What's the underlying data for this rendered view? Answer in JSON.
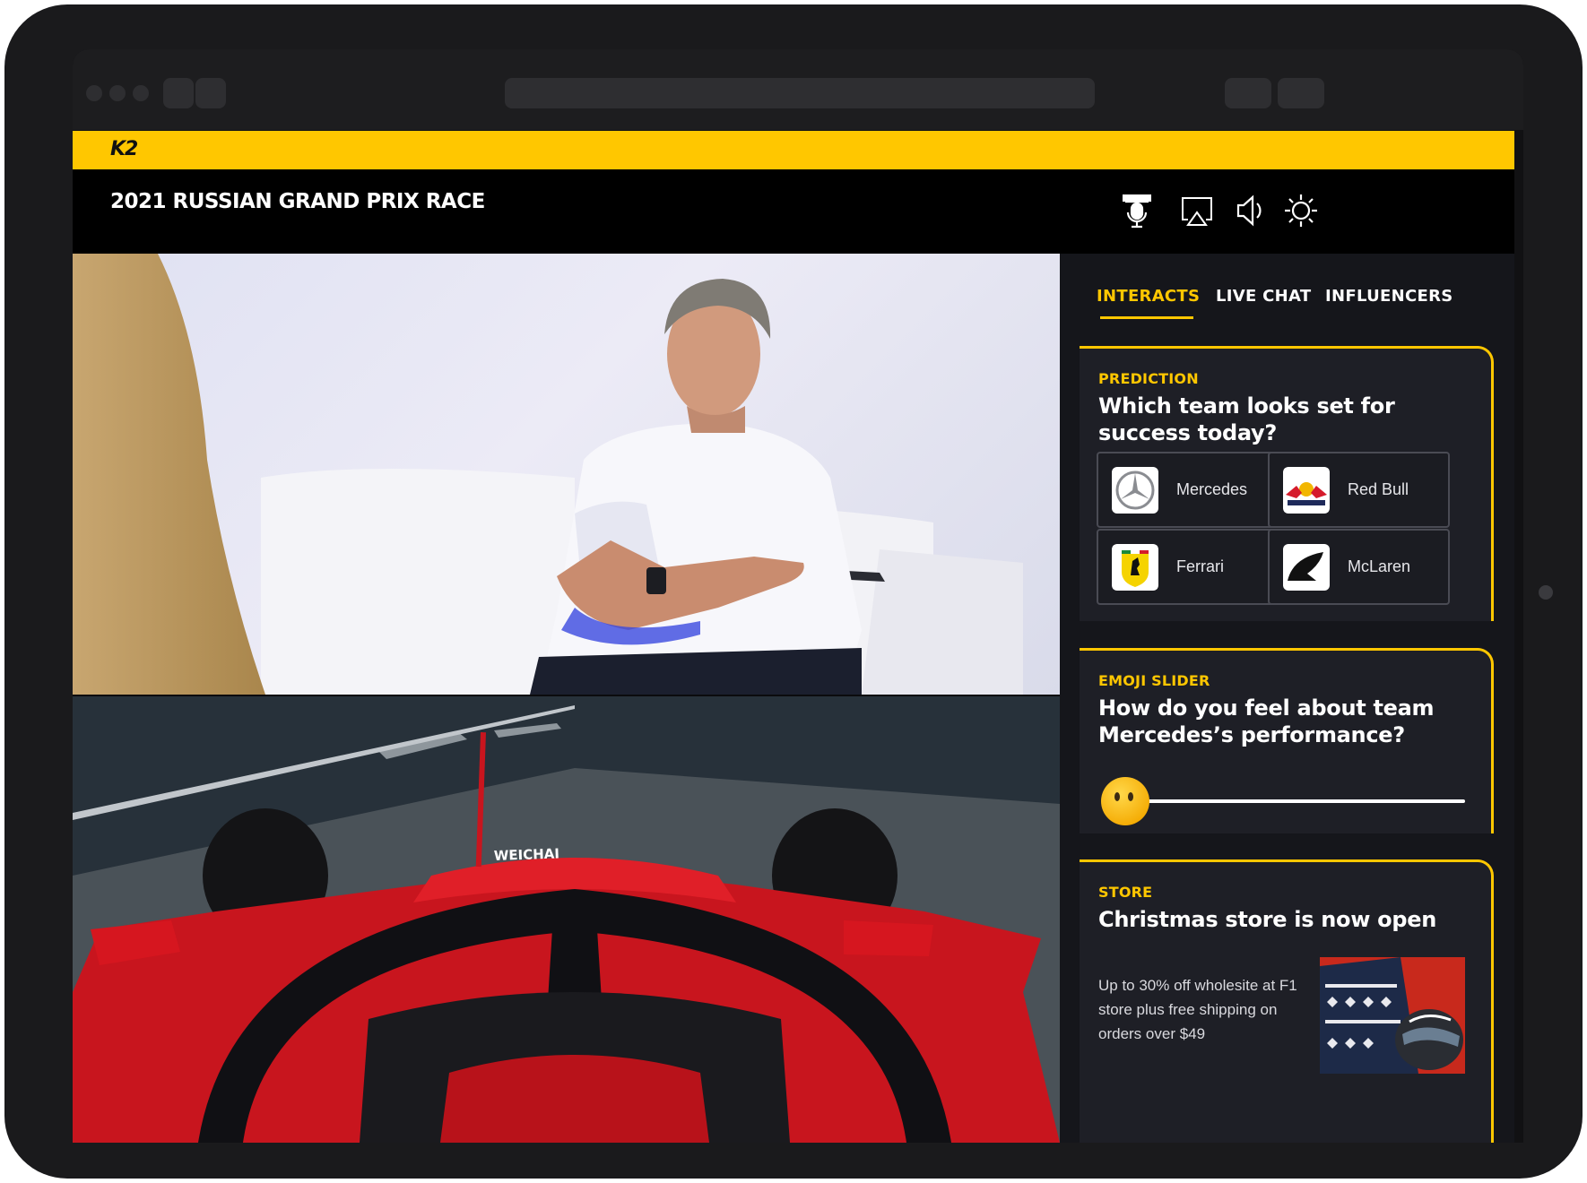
{
  "app": {
    "logo": "K2",
    "brand_color": "#ffc700"
  },
  "header": {
    "event_title": "2021 RUSSIAN GRAND PRIX RACE",
    "icons": [
      "podium-mic-icon",
      "airplay-icon",
      "volume-icon",
      "brightness-icon"
    ]
  },
  "video": {
    "top_feed": "interview-feed",
    "bottom_feed": "onboard-camera-feed"
  },
  "panel": {
    "tabs": [
      {
        "label": "INTERACTS",
        "active": true
      },
      {
        "label": "LIVE CHAT",
        "active": false
      },
      {
        "label": "INFLUENCERS",
        "active": false
      }
    ],
    "prediction": {
      "kicker": "PREDICTION",
      "question": "Which team looks set for success today?",
      "options": [
        {
          "label": "Mercedes",
          "icon": "mercedes-logo"
        },
        {
          "label": "Red Bull",
          "icon": "red-bull-logo"
        },
        {
          "label": "Ferrari",
          "icon": "ferrari-logo"
        },
        {
          "label": "McLaren",
          "icon": "mclaren-logo"
        }
      ]
    },
    "emoji_slider": {
      "kicker": "EMOJI SLIDER",
      "question": "How do you feel about team Mercedes’s performance?",
      "value": 0,
      "emoji": "neutral-face"
    },
    "store": {
      "kicker": "STORE",
      "headline": "Christmas store is now open",
      "description": "Up to 30% off wholesite at F1 store plus free shipping on orders over $49"
    }
  }
}
